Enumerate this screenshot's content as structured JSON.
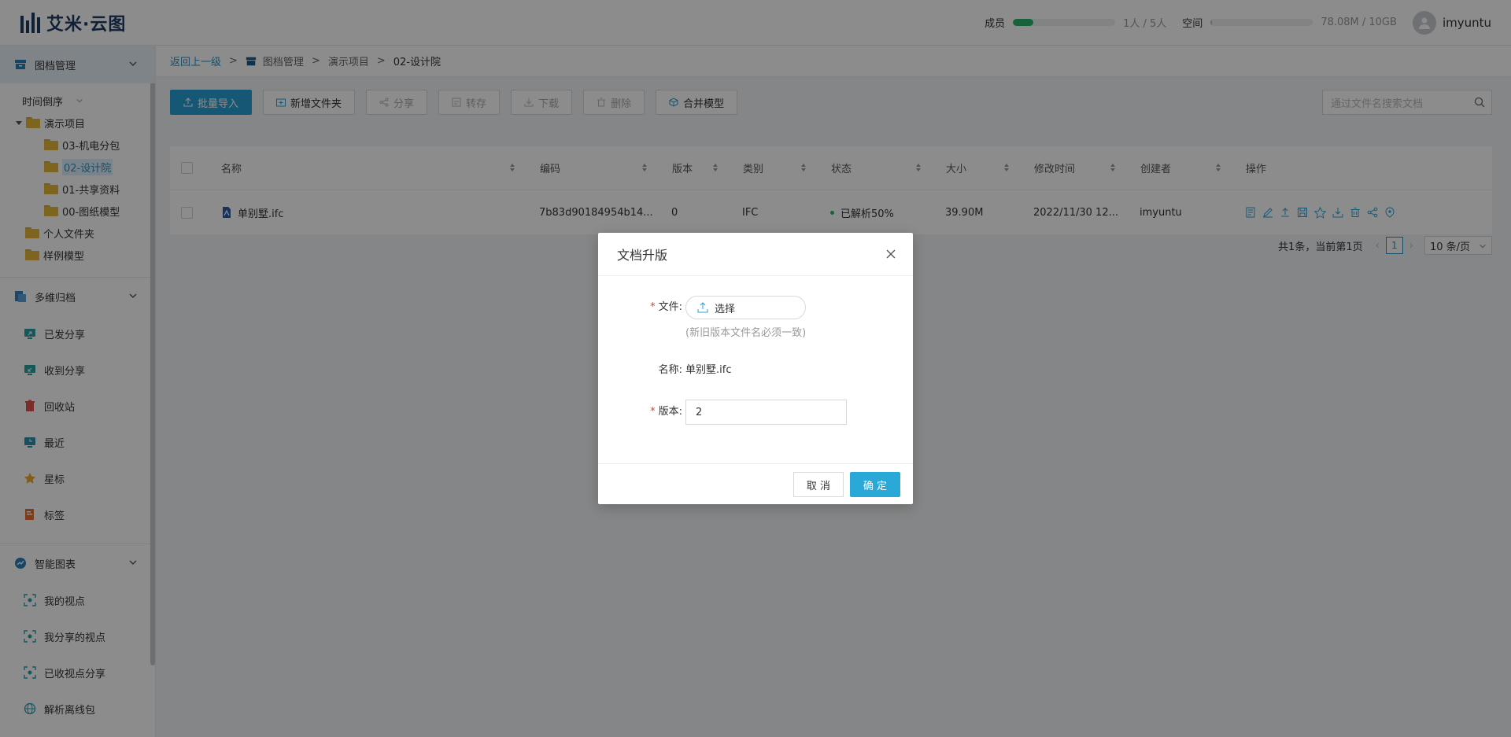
{
  "app": {
    "title": "艾米·云图"
  },
  "header": {
    "members_label": "成员",
    "members_value": "1人 / 5人",
    "members_fraction": 0.2,
    "space_label": "空间",
    "space_value": "78.08M / 10GB",
    "space_fraction": 0.008,
    "username": "imyuntu"
  },
  "sidebar": {
    "doc_mgmt": "图档管理",
    "sort_label": "时间倒序",
    "tree": {
      "root": "演示项目",
      "children": [
        "03-机电分包",
        "02-设计院",
        "01-共享资料",
        "00-图纸模型"
      ],
      "personal": "个人文件夹",
      "samples": "样例模型"
    },
    "multi_archive": "多维归档",
    "archive_items": [
      "已发分享",
      "收到分享",
      "回收站",
      "最近",
      "星标",
      "标签"
    ],
    "smart_chart": "智能图表",
    "chart_items": [
      "我的视点",
      "我分享的视点",
      "已收视点分享",
      "解析离线包"
    ]
  },
  "breadcrumb": {
    "back": "返回上一级",
    "sep": ">",
    "level1": "图档管理",
    "level2": "演示项目",
    "current": "02-设计院"
  },
  "toolbar": {
    "import": "批量导入",
    "new_folder": "新增文件夹",
    "share": "分享",
    "transfer": "转存",
    "download": "下载",
    "delete": "删除",
    "merge": "合并模型",
    "search_placeholder": "通过文件名搜索文档"
  },
  "table": {
    "columns": [
      "名称",
      "编码",
      "版本",
      "类别",
      "状态",
      "大小",
      "修改时间",
      "创建者",
      "操作"
    ],
    "rows": [
      {
        "name": "单别墅.ifc",
        "code": "7b83d90184954b14...",
        "version": "0",
        "category": "IFC",
        "status": "已解析50%",
        "size": "39.90M",
        "modified": "2022/11/30 12...",
        "creator": "imyuntu"
      }
    ]
  },
  "pager": {
    "summary": "共1条，当前第1页",
    "page": "1",
    "size": "10 条/页"
  },
  "modal": {
    "title": "文档升版",
    "file_label": "文件:",
    "choose": "选择",
    "hint": "(新旧版本文件名必须一致)",
    "name_label": "名称:",
    "name_value": "单别墅.ifc",
    "version_label": "版本:",
    "version_value": "2",
    "cancel": "取 消",
    "ok": "确 定"
  }
}
